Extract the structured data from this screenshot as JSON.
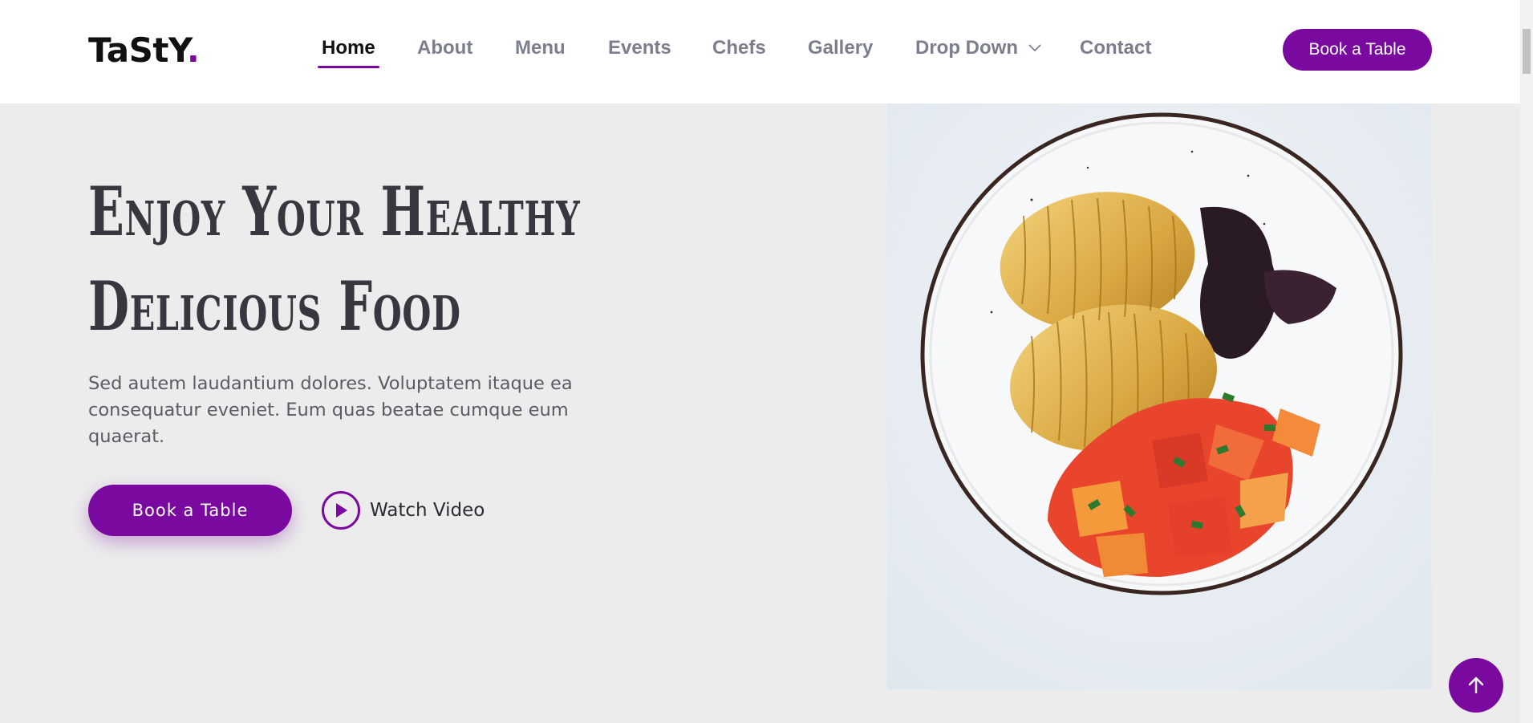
{
  "header": {
    "logo_text": "TaStY",
    "logo_dot": ".",
    "nav": [
      {
        "label": "Home",
        "active": true
      },
      {
        "label": "About"
      },
      {
        "label": "Menu"
      },
      {
        "label": "Events"
      },
      {
        "label": "Chefs"
      },
      {
        "label": "Gallery"
      },
      {
        "label": "Drop Down",
        "icon": "chevron-down-icon"
      },
      {
        "label": "Contact"
      }
    ],
    "cta_label": "Book a Table"
  },
  "hero": {
    "title_line1": "Enjoy Your Healthy",
    "title_line2": "Delicious Food",
    "description": "Sed autem laudantium dolores. Voluptatem itaque ea consequatur eveniet. Eum quas beatae cumque eum quaerat.",
    "book_button_label": "Book a Table",
    "watch_video_label": "Watch Video",
    "image_alt": "Plate of hasselback potatoes with tomato salad"
  },
  "colors": {
    "accent": "#7a0a9f",
    "background": "#ececec",
    "header_bg": "#ffffff",
    "nav_text": "#7b7e8d",
    "title_text": "#37373f"
  },
  "icons": {
    "play": "play-icon",
    "back_to_top": "arrow-up-icon",
    "dropdown": "chevron-down-icon"
  }
}
